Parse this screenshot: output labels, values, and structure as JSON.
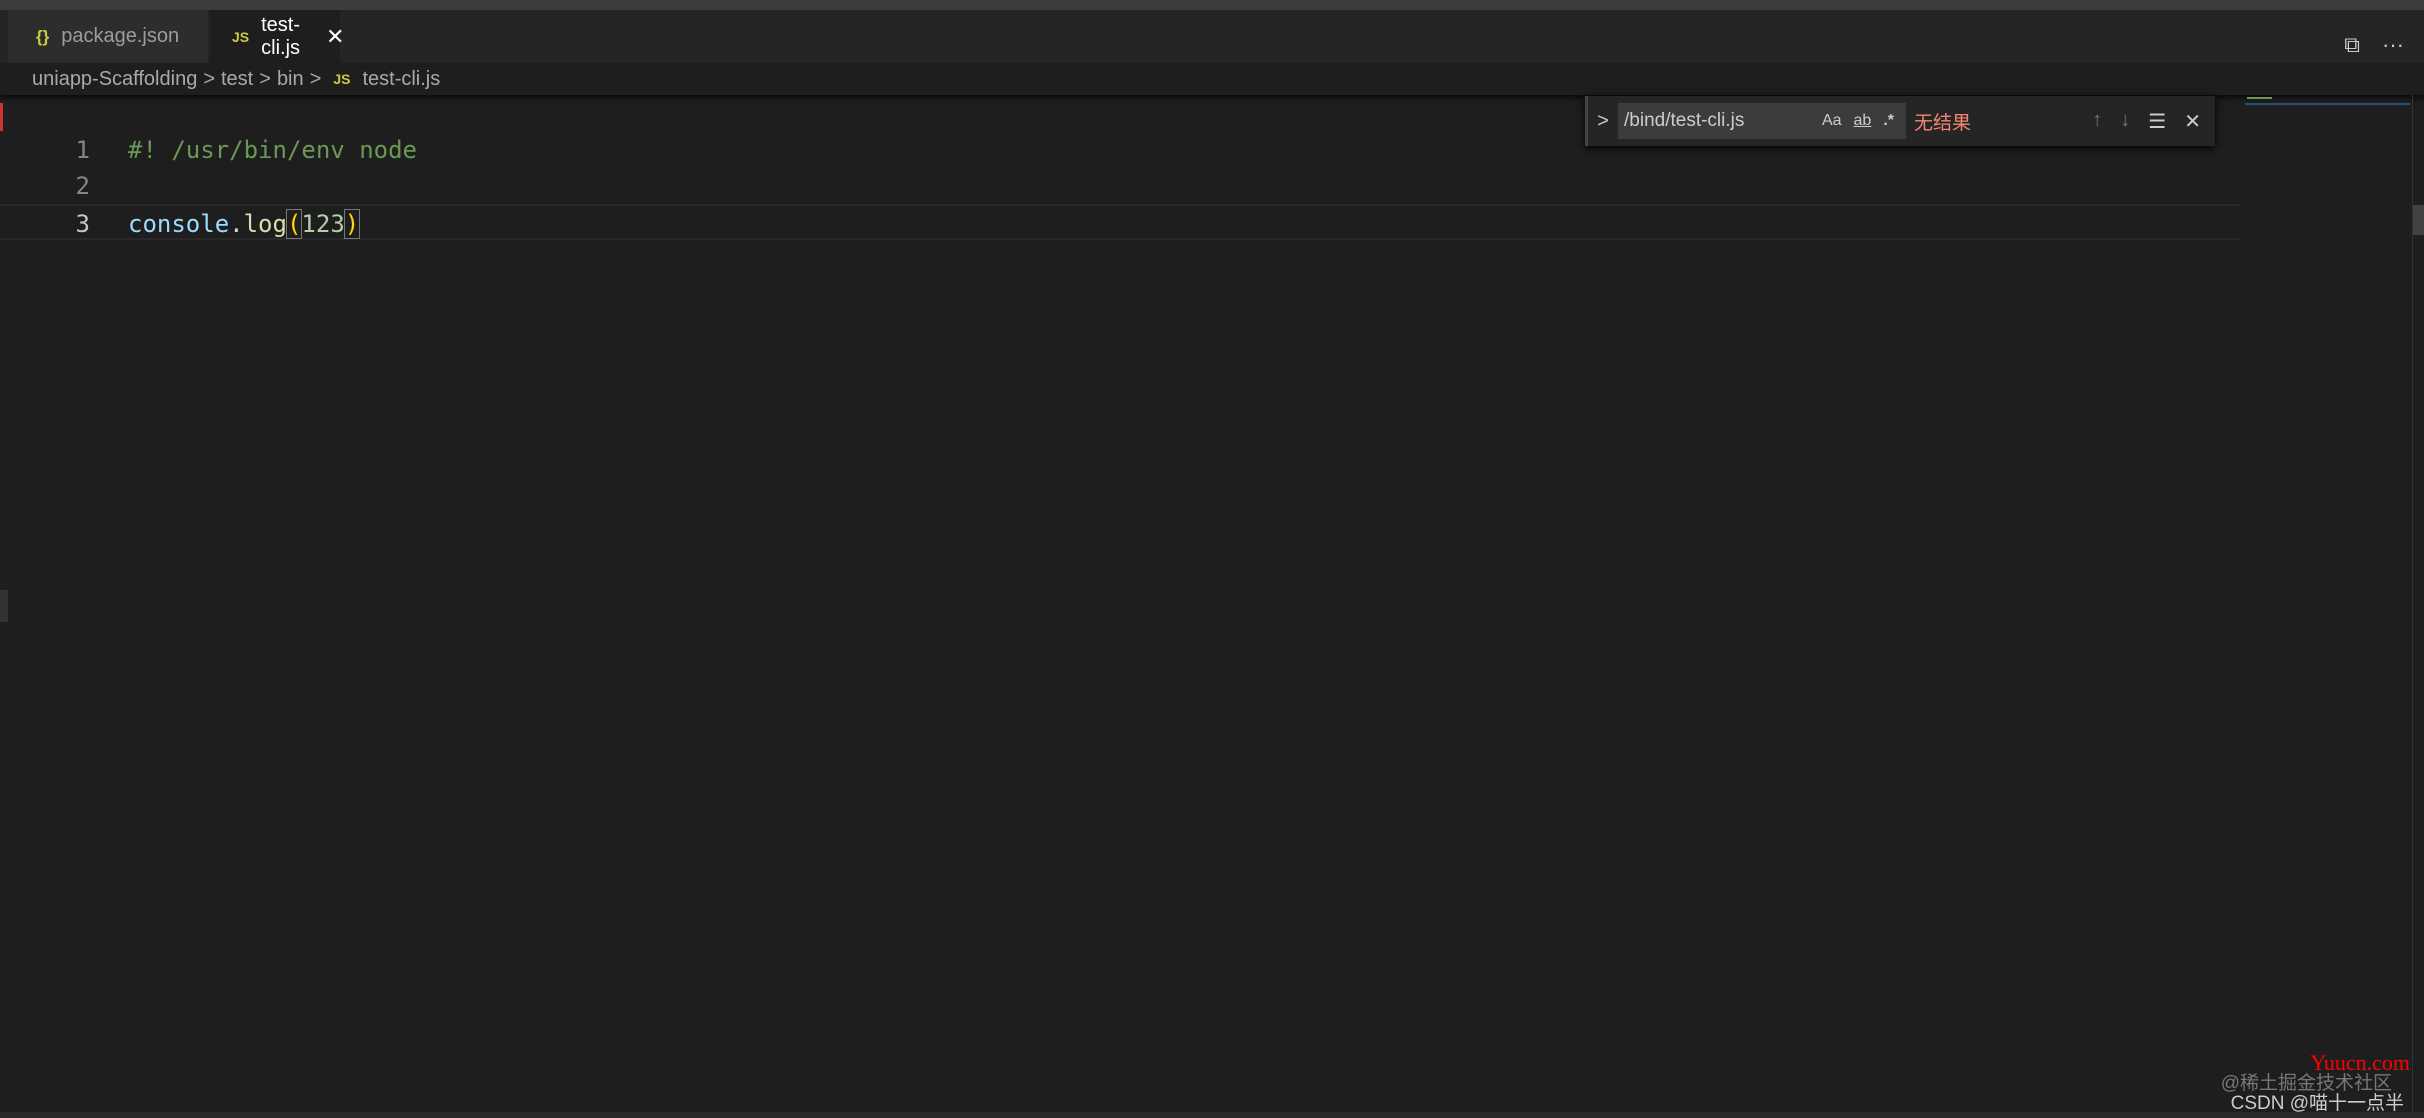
{
  "tabs": [
    {
      "label": "package.json",
      "icon": "json-braces-icon",
      "active": false
    },
    {
      "label": "test-cli.js",
      "icon": "js-icon",
      "active": true
    }
  ],
  "tab_icons": {
    "json": "{}",
    "js": "JS",
    "close": "✕"
  },
  "actions": {
    "split": "⧉",
    "more": "···"
  },
  "breadcrumb": [
    "uniapp-Scaffolding",
    "test",
    "bin",
    "test-cli.js"
  ],
  "breadcrumb_sep": ">",
  "editor": {
    "lines": [
      {
        "n": "1",
        "text": "#! /usr/bin/env node"
      },
      {
        "n": "2",
        "text": ""
      },
      {
        "n": "3",
        "fn": "console",
        "dot": ".",
        "method": "log",
        "open": "(",
        "num": "123",
        "close": ")"
      }
    ],
    "current_line": 3
  },
  "find": {
    "toggle": ">",
    "value": "/bind/test-cli.js",
    "match_case": "Aa",
    "whole_word": "ab",
    "regex": ".*",
    "status": "无结果",
    "status_color": "#f48771",
    "prev": "↑",
    "next": "↓",
    "selection": "☰",
    "close": "✕"
  },
  "watermarks": {
    "site": "Yuucn.com",
    "juejin": "@稀土掘金技术社区",
    "csdn": "CSDN @喵十一点半"
  }
}
